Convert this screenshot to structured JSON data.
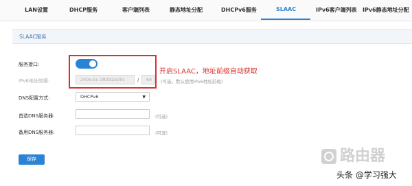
{
  "tabs": [
    {
      "label": "LAN设置"
    },
    {
      "label": "DHCP服务"
    },
    {
      "label": "客户端列表"
    },
    {
      "label": "静态地址分配"
    },
    {
      "label": "DHCPv6服务"
    },
    {
      "label": "SLAAC",
      "active": true
    },
    {
      "label": "IPv6客户端列表"
    },
    {
      "label": "IPv6静态地址分配"
    }
  ],
  "section": {
    "title": "SLAAC服务"
  },
  "form": {
    "service_interface": {
      "label": "服务接口:",
      "toggle_on": true
    },
    "ipv6_prefix": {
      "label": "IPv6地址前缀:",
      "value": "240e:5c:38292a00c",
      "prefix_length": "64",
      "hint": "(可选，默认使用IPv6地址前缀)"
    },
    "dns_mode": {
      "label": "DNS配置方式:",
      "value": "DHCPv6"
    },
    "primary_dns": {
      "label": "首选DNS服务器:",
      "value": "",
      "hint": "(可选)"
    },
    "secondary_dns": {
      "label": "备用DNS服务器:",
      "value": "",
      "hint": "(可选)"
    },
    "save_label": "保存"
  },
  "annotation": {
    "text": "开启SLAAC，地址前缀自动获取",
    "color": "#d9302e"
  },
  "watermark": {
    "text": "路由器"
  },
  "author": {
    "text": "头条 @学习强大"
  },
  "colors": {
    "accent": "#2b83d6"
  }
}
